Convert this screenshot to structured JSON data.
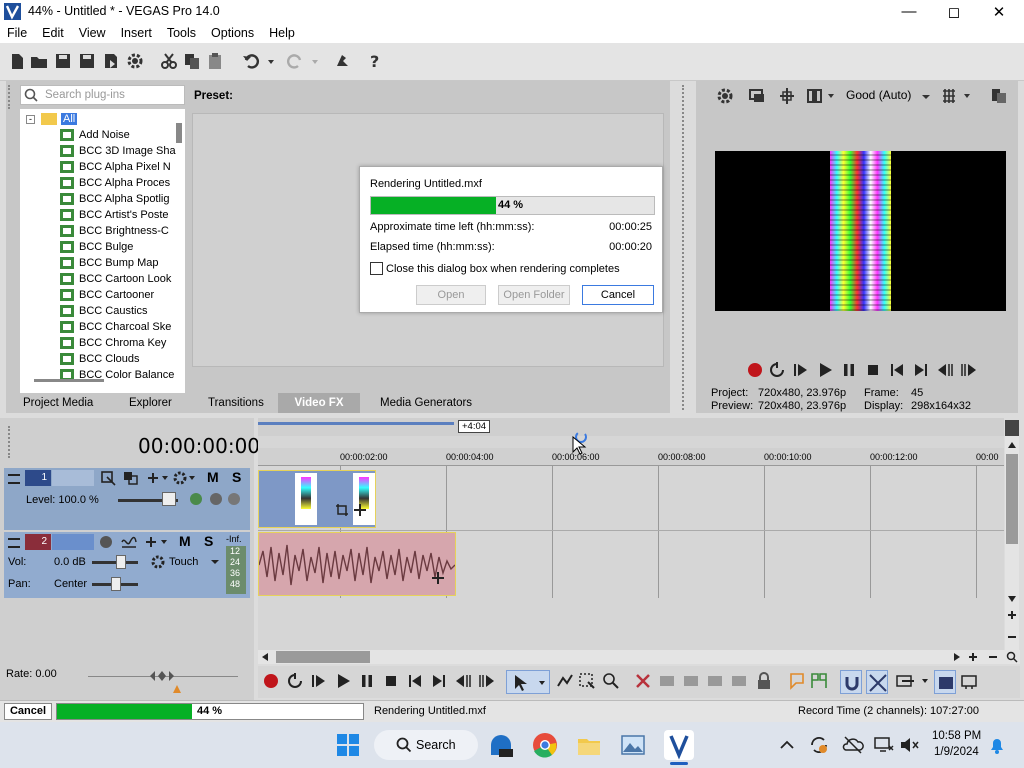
{
  "window": {
    "title": "44% - Untitled * - VEGAS Pro 14.0"
  },
  "menu": [
    "File",
    "Edit",
    "View",
    "Insert",
    "Tools",
    "Options",
    "Help"
  ],
  "plugins": {
    "search_placeholder": "Search plug-ins",
    "root": "All",
    "preset_label": "Preset:",
    "items": [
      "Add Noise",
      "BCC 3D Image Sha",
      "BCC Alpha Pixel N",
      "BCC Alpha Proces",
      "BCC Alpha Spotlig",
      "BCC Artist's Poste",
      "BCC Brightness-C",
      "BCC Bulge",
      "BCC Bump Map",
      "BCC Cartoon Look",
      "BCC Cartooner",
      "BCC Caustics",
      "BCC Charcoal Ske",
      "BCC Chroma Key",
      "BCC Clouds",
      "BCC Color Balance"
    ]
  },
  "tabs": [
    "Project Media",
    "Explorer",
    "Transitions",
    "Video FX",
    "Media Generators"
  ],
  "active_tab": "Video FX",
  "render_dialog": {
    "title": "Rendering Untitled.mxf",
    "progress_percent": 44,
    "progress_text": "44 %",
    "time_left_label": "Approximate time left (hh:mm:ss):",
    "time_left_value": "00:00:25",
    "elapsed_label": "Elapsed time (hh:mm:ss):",
    "elapsed_value": "00:00:20",
    "close_checkbox_label": "Close this dialog box when rendering completes",
    "close_checked": false,
    "open_button": "Open",
    "open_folder_button": "Open Folder",
    "cancel_button": "Cancel"
  },
  "preview": {
    "quality": "Good (Auto)",
    "project_label": "Project:",
    "project_value": "720x480, 23.976p",
    "preview_label": "Preview:",
    "preview_value": "720x480, 23.976p",
    "frame_label": "Frame:",
    "frame_value": "45",
    "display_label": "Display:",
    "display_value": "298x164x32"
  },
  "timeline": {
    "timecode": "00:00:00:00",
    "offset_badge": "+4:04",
    "ruler": [
      "00:00:02:00",
      "00:00:04:00",
      "00:00:06:00",
      "00:00:08:00",
      "00:00:10:00",
      "00:00:12:00",
      "00:00"
    ],
    "track1": {
      "number": "1",
      "level": "Level: 100.0 %",
      "m": "M",
      "s": "S"
    },
    "track2": {
      "number": "2",
      "vol_label": "Vol:",
      "vol_value": "0.0 dB",
      "pan_label": "Pan:",
      "pan_value": "Center",
      "automation": "Touch",
      "m": "M",
      "s": "S",
      "meter_top": "-Inf.",
      "meter_scale": [
        "12",
        "24",
        "36",
        "48"
      ]
    },
    "rate": "Rate: 0.00"
  },
  "status": {
    "cancel_button": "Cancel",
    "progress_percent": 44,
    "progress_text": "44 %",
    "message": "Rendering Untitled.mxf",
    "record_time": "Record Time (2 channels): 107:27:00"
  },
  "taskbar": {
    "search": "Search",
    "time": "10:58 PM",
    "date": "1/9/2024"
  }
}
